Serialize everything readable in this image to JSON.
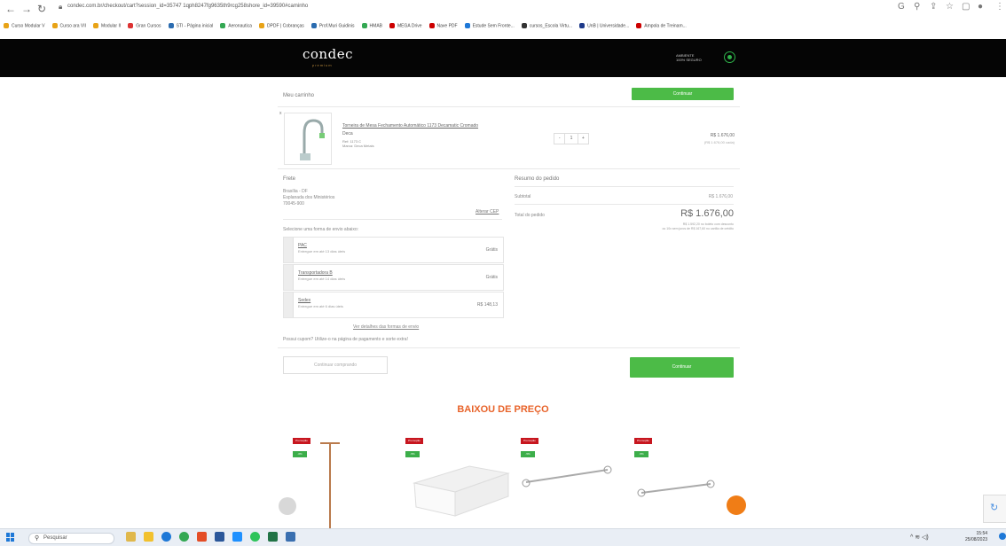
{
  "browser": {
    "url": "condec.com.br/checkout/cart?session_id=35747 1qph8247fg9635th9rcg258shore_id=39590#caminho",
    "bookmarks": [
      "Curso Modular V",
      "Curso ara VII",
      "Modular II",
      "Gran Cursos",
      "STI - Página inicial",
      "Aeronautica",
      "DPDF | Cobranças",
      "Prof.Muri Guidinis",
      "HMAB",
      "MEGA Drive",
      "Nave PDF",
      "Estude Sem Fronte...",
      "cursos_Escola Virtu...",
      "UnB | Universidade...",
      "Ampola de Treinam..."
    ]
  },
  "site": {
    "logo": "condec",
    "logo_sub": "premium",
    "secure_line1": "AMBIENTE",
    "secure_line2": "100% SEGURO"
  },
  "cart": {
    "title": "Meu carrinho",
    "continue_label": "Continuar",
    "item": {
      "remove": "x",
      "name_line1": "Torneira de Mesa Fechamento Automático 1173 Decamatic Cromado",
      "name_line2": "Deca",
      "ref": "Ref: 1173 C",
      "brand": "Marca: Deca Metais",
      "qty_minus": "-",
      "qty": "1",
      "qty_plus": "+",
      "price": "R$ 1.676,00",
      "price_note": "(R$ 1.676,00 cada)"
    }
  },
  "shipping": {
    "title": "Frete",
    "city": "Brasília - DF",
    "address": "Esplanada dos Ministérios",
    "cep": "70045-900",
    "change_cep": "Alterar CEP",
    "select_label": "Selecione uma forma de envio abaixo:",
    "options": [
      {
        "name": "PAC",
        "desc": "Entregue em até 13 dias úteis",
        "price": "Grátis"
      },
      {
        "name": "Transportadora B",
        "desc": "Entregue em até 14 dias úteis",
        "price": "Grátis"
      },
      {
        "name": "Sedex",
        "desc": "Entregue em até 6 dias úteis",
        "price": "R$ 148,13"
      }
    ],
    "details_link": "Ver detalhes das formas de envio",
    "coupon_text": "Possui cupom? Utilize-o na página de pagamento e sorte extra!",
    "keep_buying": "Continuar comprando"
  },
  "summary": {
    "title": "Resumo do pedido",
    "subtotal_label": "Subtotal",
    "subtotal_value": "R$ 1.676,00",
    "total_label": "Total do pedido",
    "total_value": "R$ 1.676,00",
    "installment_line1": "R$ 1.592,20 no boleto com desconto",
    "installment_line2": "ou 10x sem juros de R$ 167,60 no cartão de crédito"
  },
  "promo_section": {
    "title": "BAIXOU DE PREÇO",
    "promo_badge": "Promoção",
    "products": [
      {
        "discount": "-6%"
      },
      {
        "discount": "-5%"
      },
      {
        "discount": "-5%"
      },
      {
        "discount": "-5%"
      }
    ]
  },
  "taskbar": {
    "search_placeholder": "Pesquisar",
    "time": "15:54",
    "date": "25/08/2023"
  },
  "colors": {
    "header_bg": "#050505",
    "accent_green": "#4cbb47",
    "promo_red": "#c7161f",
    "promo_title": "#e8632a"
  }
}
